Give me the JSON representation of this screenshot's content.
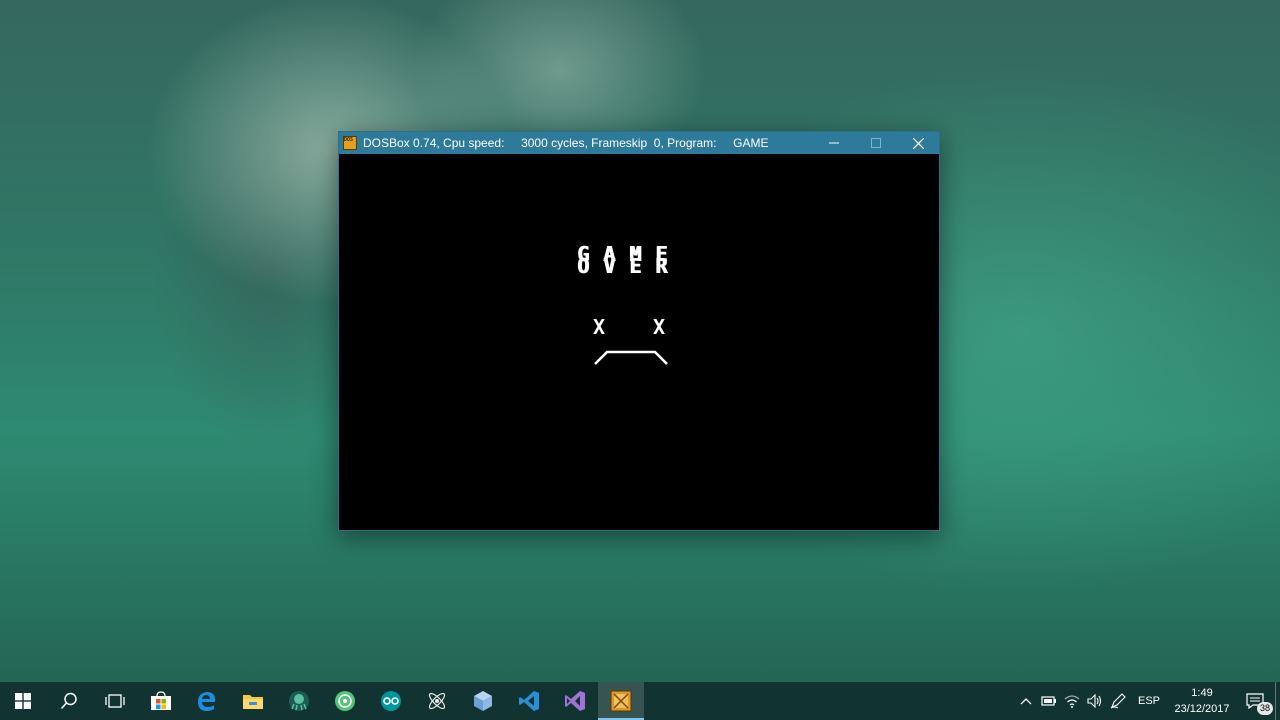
{
  "window": {
    "app_icon_label": "DOS BOX",
    "title": "DOSBox 0.74, Cpu speed:     3000 cycles, Frameskip  0, Program:     GAME",
    "minimize_icon": "minimize-icon",
    "maximize_icon": "maximize-icon",
    "close_icon": "close-icon"
  },
  "game": {
    "line1": "GAME",
    "line2": "OVER",
    "eye_left": "X",
    "eye_right": "X"
  },
  "taskbar": {
    "items": [
      {
        "name": "start",
        "icon": "windows-logo-icon"
      },
      {
        "name": "search",
        "icon": "search-icon"
      },
      {
        "name": "task-view",
        "icon": "task-view-icon"
      },
      {
        "name": "store",
        "icon": "store-icon"
      },
      {
        "name": "edge",
        "icon": "edge-icon"
      },
      {
        "name": "file-explorer",
        "icon": "folder-icon"
      },
      {
        "name": "gitkraken",
        "icon": "gitkraken-icon"
      },
      {
        "name": "atom-green",
        "icon": "green-app-icon"
      },
      {
        "name": "arduino",
        "icon": "arduino-icon"
      },
      {
        "name": "atom",
        "icon": "atom-icon"
      },
      {
        "name": "virtualbox",
        "icon": "cube-icon"
      },
      {
        "name": "vscode",
        "icon": "vscode-icon"
      },
      {
        "name": "visual-studio",
        "icon": "visual-studio-icon"
      },
      {
        "name": "dosbox",
        "icon": "dosbox-icon",
        "active": true
      }
    ],
    "tray": {
      "language": "ESP",
      "time": "1:49",
      "date": "23/12/2017",
      "notification_count": "38"
    }
  },
  "colors": {
    "titlebar": "#2e7a9a",
    "taskbar": "#103030",
    "active_indicator": "#7fc7ea"
  }
}
